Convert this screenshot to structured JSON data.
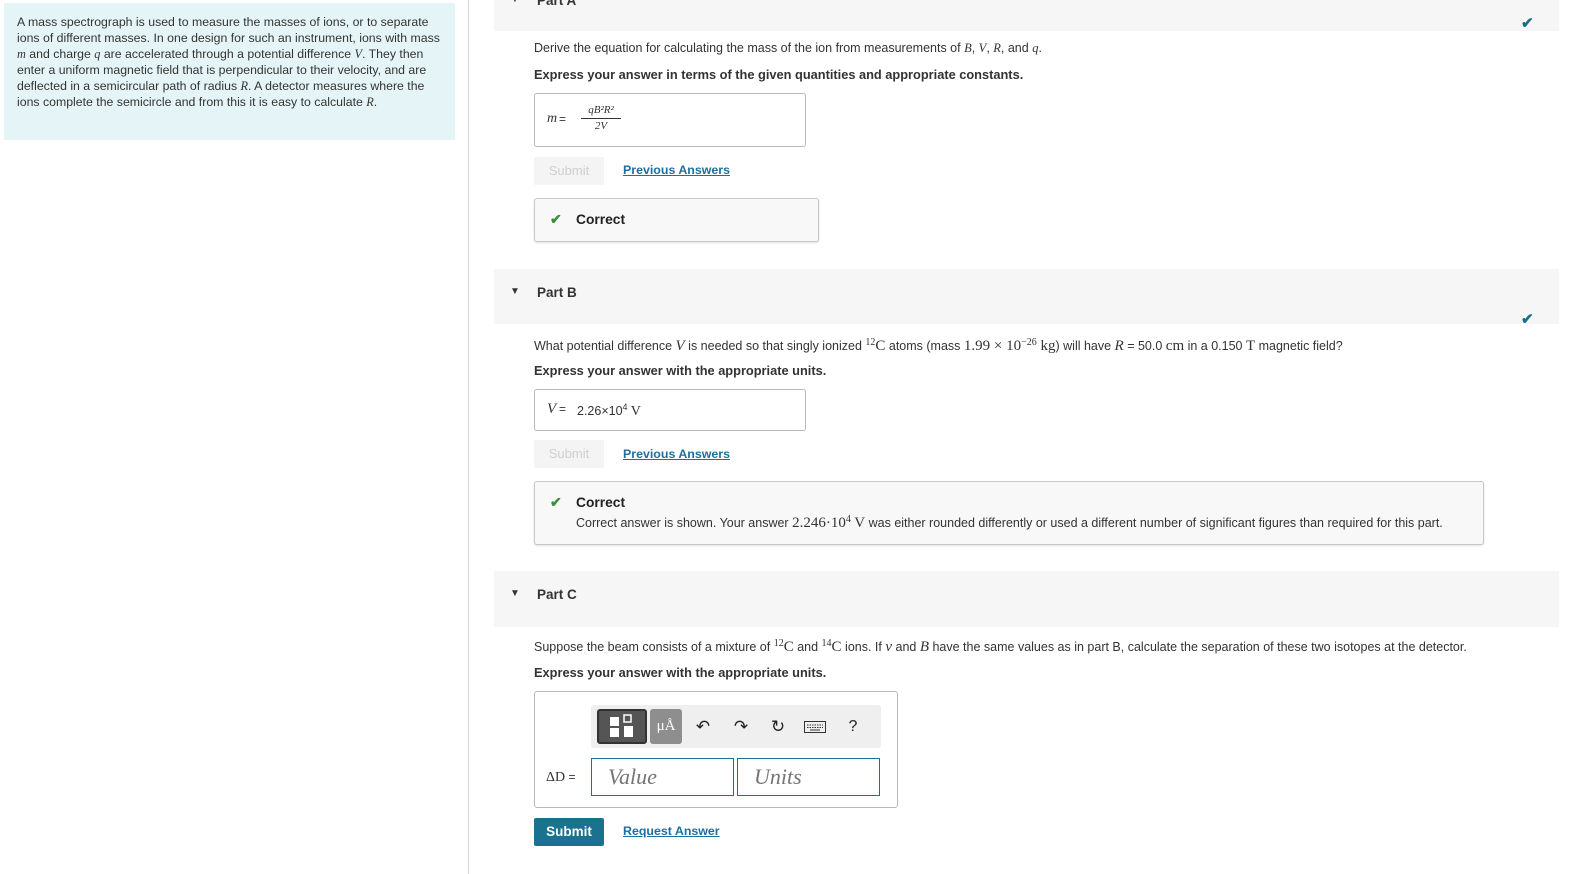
{
  "intro": {
    "text_1": "A mass spectrograph is used to measure the masses of ions, or to separate ions of different masses. In one design for such an instrument, ions with mass ",
    "m": "m",
    "text_2": " and charge ",
    "q": "q",
    "text_3": " are accelerated through a potential difference ",
    "V": "V",
    "text_4": ". They then enter a uniform magnetic field that is perpendicular to their velocity, and are deflected in a semicircular path of radius ",
    "R": "R",
    "text_5": ". A detector measures where the ions complete the semicircle and from this it is easy to calculate ",
    "R2": "R",
    "text_6": "."
  },
  "part_a": {
    "title_partial": "Part A",
    "question_pre": "Derive the equation for calculating the mass of the ion from measurements of ",
    "B": "B",
    "comma1": ", ",
    "V": "V",
    "comma2": ", ",
    "R": "R",
    "and": ", and ",
    "q": "q",
    "period": ".",
    "instruction": "Express your answer in terms of the given quantities and appropriate constants.",
    "answer_label": "m",
    "answer_eq": " = ",
    "answer_numerator": "qB²R²",
    "answer_denominator": "2V",
    "submit_label": "Submit",
    "previous_answers": "Previous Answers",
    "feedback_title": "Correct"
  },
  "part_b": {
    "title": "Part B",
    "q_pre": "What potential difference ",
    "V": "V",
    "q_mid1": " is needed so that singly ionized ",
    "isotope_sup": "12",
    "isotope_el": "C",
    "q_mid2": " atoms (mass ",
    "mass_val": "1.99 × 10",
    "mass_exp": "−26",
    "mass_unit": " kg",
    "q_mid3": ") will have ",
    "R": "R",
    "q_mid4": " = 50.0 ",
    "cm": "cm",
    "q_mid5": " in a 0.150 ",
    "T": "T",
    "q_end": " magnetic field?",
    "instruction": "Express your answer with the appropriate units.",
    "answer_label": "V",
    "answer_eq": " = ",
    "answer_mantissa": "2.26×10",
    "answer_exp": "4",
    "answer_unit": " V",
    "submit_label": "Submit",
    "previous_answers": "Previous Answers",
    "feedback_title": "Correct",
    "feedback_pre": "Correct answer is shown. Your answer ",
    "feedback_val": "2.246·10",
    "feedback_exp": "4",
    "feedback_unit": " V",
    "feedback_post": " was either rounded differently or used a different number of significant figures than required for this part."
  },
  "part_c": {
    "title": "Part C",
    "q_pre": "Suppose the beam consists of a mixture of ",
    "iso1_sup": "12",
    "iso1_el": "C",
    "q_and": " and ",
    "iso2_sup": "14",
    "iso2_el": "C",
    "q_mid": " ions. If ",
    "v": "v",
    "q_and2": " and ",
    "B": "B",
    "q_end": " have the same values as in part B, calculate the separation of these two isotopes at the detector.",
    "instruction": "Express your answer with the appropriate units.",
    "units_btn": "μÅ",
    "help_btn": "?",
    "answer_label": "ΔD",
    "answer_eq": " = ",
    "value_placeholder": "Value",
    "units_placeholder": "Units",
    "submit_label": "Submit",
    "request_answer": "Request Answer"
  }
}
